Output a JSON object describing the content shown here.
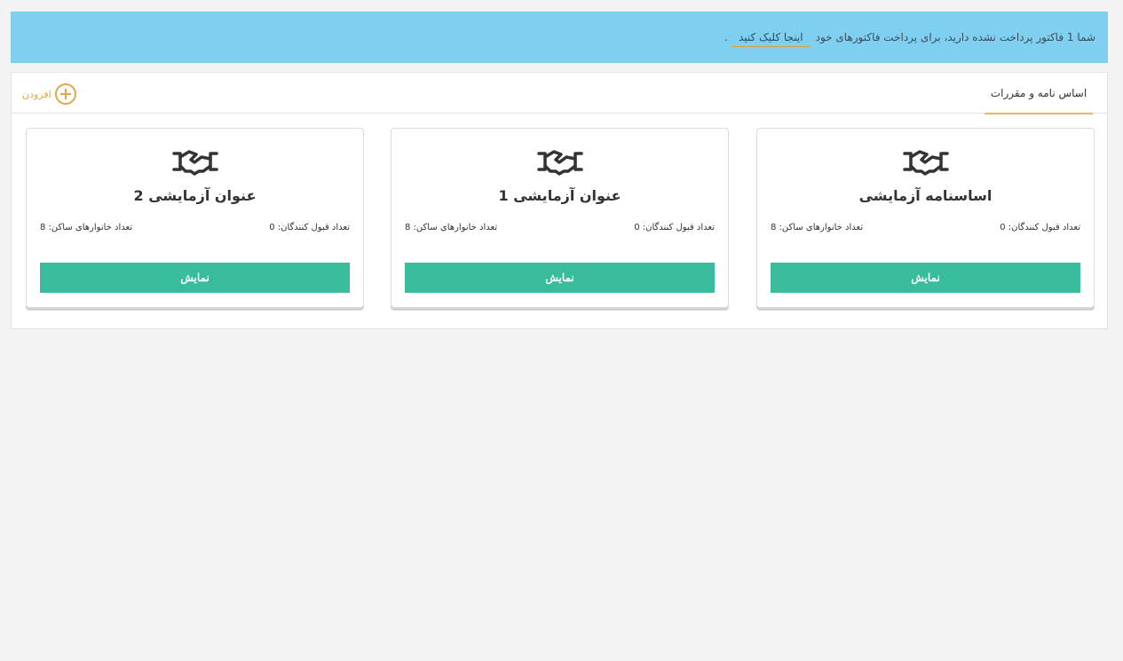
{
  "alert": {
    "message": "شما 1 فاکتور پرداخت نشده دارید، برای پرداخت فاکتورهای خود",
    "link_label": "اینجا کلیک کنید",
    "trailing": "."
  },
  "panel": {
    "tab_label": "اساس نامه و مقررات",
    "add_label": "افزودن"
  },
  "cards": [
    {
      "title": "اساسنامه آزمایشی",
      "accepted_label": "تعداد قبول کنندگان: 0",
      "households_label": "تعداد خانوارهای ساکن: 8",
      "button_label": "نمایش"
    },
    {
      "title": "عنوان آزمایشی 1",
      "accepted_label": "تعداد قبول کنندگان: 0",
      "households_label": "تعداد خانوارهای ساکن: 8",
      "button_label": "نمایش"
    },
    {
      "title": "عنوان آزمایشی 2",
      "accepted_label": "تعداد قبول کنندگان: 0",
      "households_label": "تعداد خانوارهای ساکن: 8",
      "button_label": "نمایش"
    }
  ],
  "colors": {
    "alert_bg": "#7fd0f0",
    "accent": "#e0a745",
    "button": "#38bc9c"
  },
  "icons": {
    "card_icon": "handshake-icon",
    "add_icon": "plus-circle-icon"
  }
}
